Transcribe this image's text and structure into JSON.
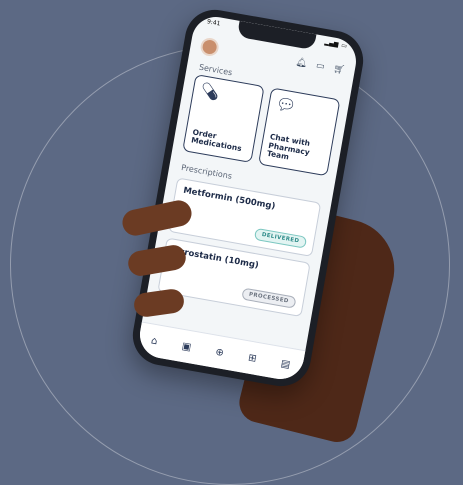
{
  "status_bar": {
    "time": "9:41"
  },
  "services": {
    "label": "Services",
    "cards": [
      {
        "title": "Order Medications",
        "icon": "pills-icon"
      },
      {
        "title": "Chat with Pharmacy Team",
        "icon": "chat-bubble-icon"
      }
    ]
  },
  "prescriptions": {
    "label": "Prescriptions",
    "items": [
      {
        "name": "Metformin (500mg)",
        "status": "DELIVERED"
      },
      {
        "name": "Avrostatin (10mg)",
        "status": "PROCESSED"
      }
    ]
  },
  "bottom_nav": [
    "home-icon",
    "orders-icon",
    "add-icon",
    "apps-icon",
    "messages-icon"
  ],
  "colors": {
    "background": "#5c6984",
    "primary": "#1d2b48",
    "accent": "#2f8c8a"
  }
}
